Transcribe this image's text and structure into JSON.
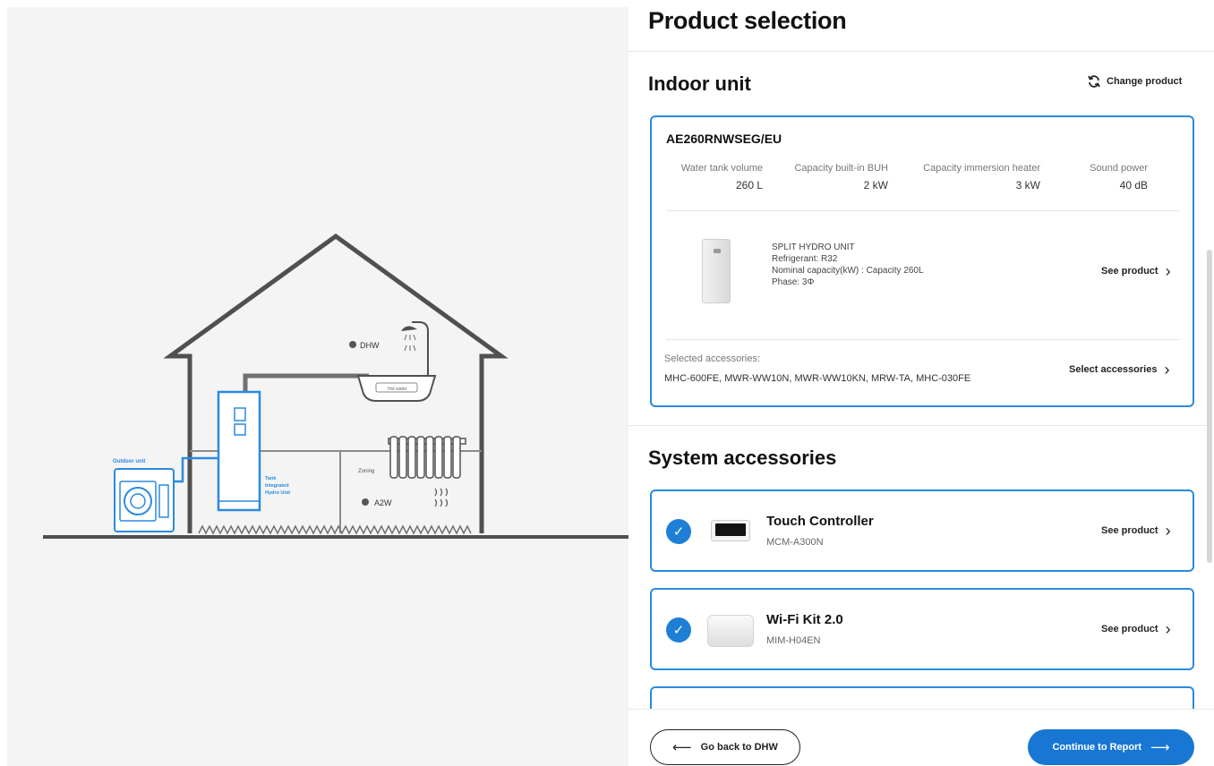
{
  "illustration": {
    "outdoor_label": "Outdoor unit",
    "tank_label": [
      "Tank",
      "Integrated",
      "Hydro Unit"
    ],
    "dhw_label": "DHW",
    "hot_water_label": "Hot water",
    "zoning_label": "Zoning",
    "a2w_label": "A2W",
    "accent_color": "#2a8ae0",
    "line_color": "#505050"
  },
  "panel": {
    "title": "Product selection"
  },
  "indoor": {
    "section_title": "Indoor unit",
    "change_product_label": "Change product",
    "change_icon": "refresh-icon",
    "model_code": "AE260RNWSEG/EU",
    "specs": [
      {
        "label": "Water tank volume",
        "value": "260 L"
      },
      {
        "label": "Capacity built-in BUH",
        "value": "2 kW"
      },
      {
        "label": "Capacity immersion heater",
        "value": "3 kW"
      },
      {
        "label": "Sound power",
        "value": "40 dB"
      }
    ],
    "description": [
      "SPLIT HYDRO UNIT",
      "Refrigerant: R32",
      "Nominal capacity(kW) : Capacity 260L",
      "Phase: 3Φ"
    ],
    "see_product_label": "See product",
    "selected_accessories_label": "Selected accessories:",
    "selected_accessories_value": "MHC-600FE, MWR-WW10N, MWR-WW10KN, MRW-TA, MHC-030FE",
    "select_accessories_label": "Select accessories"
  },
  "system": {
    "section_title": "System accessories",
    "items": [
      {
        "name": "Touch Controller",
        "code": "MCM-A300N",
        "link": "See product",
        "checked": true
      },
      {
        "name": "Wi-Fi Kit 2.0",
        "code": "MIM-H04EN",
        "link": "See product",
        "checked": true
      }
    ]
  },
  "footer": {
    "back_label": "Go back to DHW",
    "next_label": "Continue to Report",
    "primary_color": "#1877d2"
  }
}
